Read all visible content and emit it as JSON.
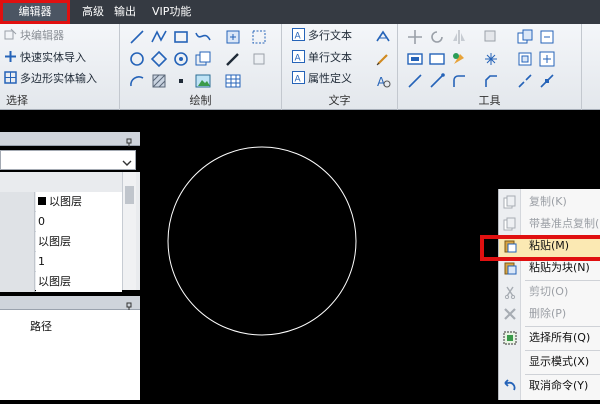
{
  "menubar": {
    "items": [
      "编辑器",
      "高级",
      "输出",
      "VIP功能"
    ]
  },
  "ribbon": {
    "select_group": {
      "items": [
        "块编辑器",
        "快速实体导入",
        "多边形实体输入"
      ],
      "label": "选择"
    },
    "draw_group": {
      "label": "绘制"
    },
    "text_group": {
      "items": [
        "多行文本",
        "单行文本",
        "属性定义"
      ],
      "label": "文字"
    },
    "tools_group": {
      "label": "工具"
    }
  },
  "left_panel": {
    "rows": [
      "以图层",
      "0",
      "以图层",
      "1",
      "以图层"
    ],
    "path_label": "路径"
  },
  "context_menu": {
    "items": [
      {
        "label": "复制(K)",
        "state": "disabled"
      },
      {
        "label": "带基准点复制(",
        "state": "disabled"
      },
      {
        "label": "粘贴(M)",
        "state": "active"
      },
      {
        "label": "粘贴为块(N)",
        "state": "enabled"
      },
      {
        "label": "剪切(O)",
        "state": "disabled"
      },
      {
        "label": "删除(P)",
        "state": "disabled"
      },
      {
        "label": "选择所有(Q)",
        "state": "enabled"
      },
      {
        "label": "显示模式(X)",
        "state": "enabled"
      },
      {
        "label": "取消命令(Y)",
        "state": "enabled"
      }
    ]
  },
  "colors": {
    "menubar_bg": "#353a42",
    "highlight_red": "#e01010",
    "canvas_bg": "#000000",
    "circle_stroke": "#ffffff",
    "menu_active_bg": "#fbe9b3"
  }
}
